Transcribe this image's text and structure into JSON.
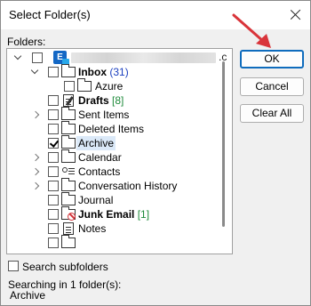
{
  "window": {
    "title": "Select Folder(s)"
  },
  "labels": {
    "folders": "Folders:"
  },
  "tree": {
    "root_suffix": ".c",
    "root_icon_letter": "E",
    "items": [
      {
        "label": "Inbox",
        "count": "(31)",
        "bold": true,
        "checked": false
      },
      {
        "label": "Azure",
        "count": "",
        "bold": false,
        "checked": false
      },
      {
        "label": "Drafts",
        "count": "[8]",
        "bold": true,
        "checked": false
      },
      {
        "label": "Sent Items",
        "count": "",
        "bold": false,
        "checked": false
      },
      {
        "label": "Deleted Items",
        "count": "",
        "bold": false,
        "checked": false
      },
      {
        "label": "Archive",
        "count": "",
        "bold": false,
        "checked": true
      },
      {
        "label": "Calendar",
        "count": "",
        "bold": false,
        "checked": false
      },
      {
        "label": "Contacts",
        "count": "",
        "bold": false,
        "checked": false
      },
      {
        "label": "Conversation History",
        "count": "",
        "bold": false,
        "checked": false
      },
      {
        "label": "Journal",
        "count": "",
        "bold": false,
        "checked": false
      },
      {
        "label": "Junk Email",
        "count": "[1]",
        "bold": true,
        "checked": false
      },
      {
        "label": "Notes",
        "count": "",
        "bold": false,
        "checked": false
      }
    ]
  },
  "buttons": {
    "ok": "OK",
    "cancel": "Cancel",
    "clear_all": "Clear All"
  },
  "options": {
    "search_subfolders": "Search subfolders",
    "search_subfolders_checked": false
  },
  "status": {
    "line1": "Searching in 1 folder(s):",
    "line2": "Archive"
  },
  "colors": {
    "accent": "#0f6cbd",
    "arrow": "#d9343a",
    "count_blue": "#1a3fbf",
    "count_green": "#1e8a3a",
    "selection": "#dbe9f8"
  }
}
